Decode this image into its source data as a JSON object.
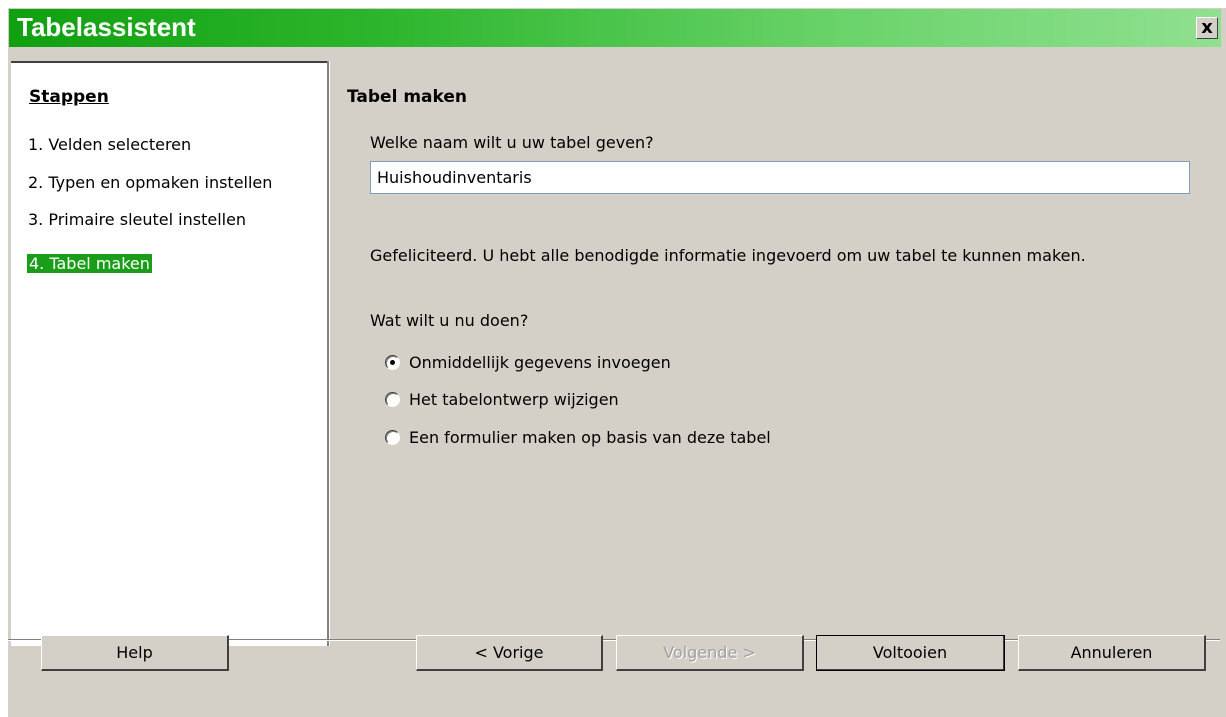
{
  "window": {
    "title": "Tabelassistent",
    "close_label": "x"
  },
  "steps": {
    "title": "Stappen",
    "items": [
      {
        "label": "1. Velden selecteren",
        "active": false
      },
      {
        "label": "2. Typen en opmaken instellen",
        "active": false
      },
      {
        "label": "3. Primaire sleutel instellen",
        "active": false
      },
      {
        "label": "4. Tabel maken",
        "active": true
      }
    ]
  },
  "main": {
    "title": "Tabel maken",
    "name_prompt": "Welke naam wilt u uw tabel geven?",
    "name_value": "Huishoudinventaris",
    "congrats": "Gefeliciteerd. U hebt alle benodigde informatie ingevoerd om uw tabel te kunnen maken.",
    "question": "Wat wilt u nu doen?",
    "options": [
      {
        "label": "Onmiddellijk gegevens invoegen",
        "checked": true
      },
      {
        "label": "Het tabelontwerp wijzigen",
        "checked": false
      },
      {
        "label": "Een formulier maken op basis van deze tabel",
        "checked": false
      }
    ]
  },
  "buttons": {
    "help": "Help",
    "back": "< Vorige",
    "next": "Volgende >",
    "finish": "Voltooien",
    "cancel": "Annuleren"
  }
}
